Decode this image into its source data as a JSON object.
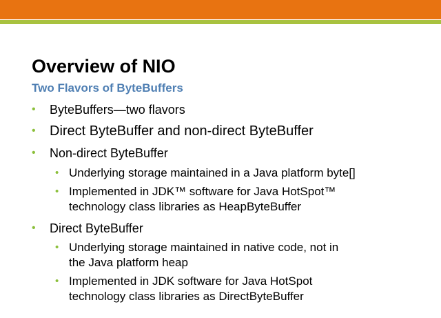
{
  "slide": {
    "title": "Overview of NIO",
    "subtitle": "Two Flavors of ByteBuffers",
    "bullet_glyph": "•",
    "colors": {
      "top_band": "#e87311",
      "accent_band": "#a8c23f",
      "subtitle": "#4f7fb3",
      "bullet": "#8bbf3a"
    },
    "bullets": [
      {
        "text": "ByteBuffers—two flavors"
      },
      {
        "text": "Direct ByteBuffer and non-direct ByteBuffer"
      },
      {
        "text": "Non-direct ByteBuffer"
      },
      {
        "text": "Underlying storage maintained in a Java platform byte[]"
      },
      {
        "line1": "Implemented in JDK™ software for Java HotSpot™",
        "line2": "technology class libraries as HeapByteBuffer"
      },
      {
        "text": "Direct ByteBuffer"
      },
      {
        "line1": "Underlying storage maintained in native code, not in",
        "line2": "the Java platform heap"
      },
      {
        "line1": "Implemented in JDK software for Java HotSpot",
        "line2": "technology class libraries as DirectByteBuffer"
      }
    ]
  }
}
